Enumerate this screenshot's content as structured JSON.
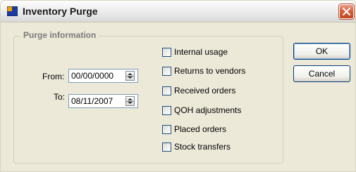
{
  "window": {
    "title": "Inventory Purge"
  },
  "icons": {
    "app": "app-icon",
    "close": "close-icon",
    "spinner": "spin-updown-icon"
  },
  "group": {
    "title": "Purge information",
    "from": {
      "label": "From:",
      "value": "00/00/0000"
    },
    "to": {
      "label": "To:",
      "value": "08/11/2007"
    },
    "checkboxes": [
      {
        "label": "Internal usage",
        "checked": false
      },
      {
        "label": "Returns to vendors",
        "checked": false
      },
      {
        "label": "Received orders",
        "checked": false
      },
      {
        "label": "QOH adjustments",
        "checked": false
      },
      {
        "label": "Placed orders",
        "checked": false
      },
      {
        "label": "Stock transfers",
        "checked": false
      }
    ]
  },
  "buttons": {
    "ok": "OK",
    "cancel": "Cancel"
  }
}
